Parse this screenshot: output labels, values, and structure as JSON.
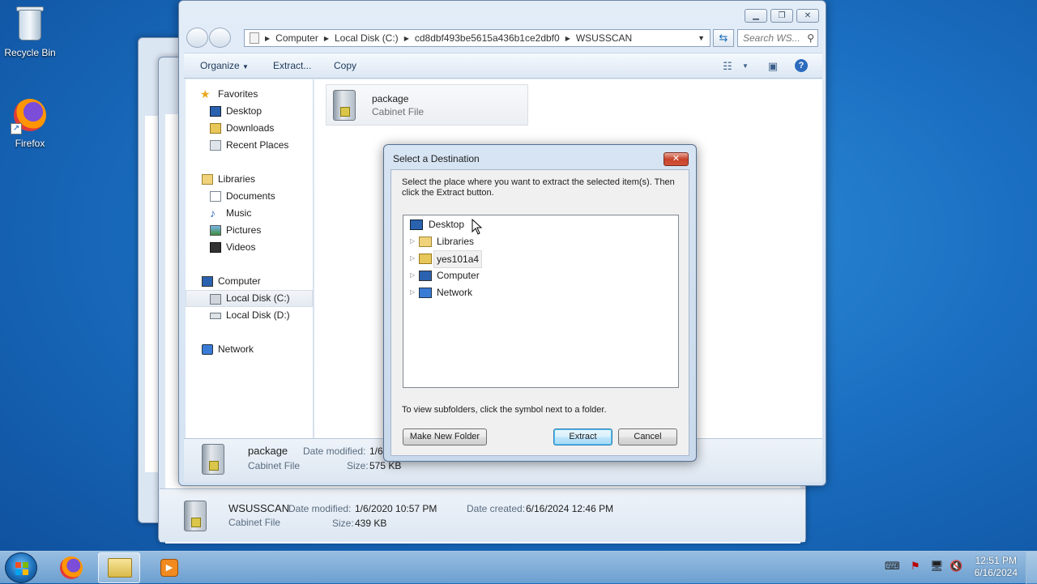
{
  "desktop": {
    "icons": [
      {
        "label": "Recycle Bin"
      },
      {
        "label": "Firefox"
      }
    ]
  },
  "explorer": {
    "address": [
      "Computer",
      "Local Disk (C:)",
      "cd8dbf493be5615a436b1ce2dbf0",
      "WSUSSCAN"
    ],
    "search_placeholder": "Search WS...",
    "toolbar": {
      "organize": "Organize",
      "extract": "Extract...",
      "copy": "Copy"
    },
    "nav": {
      "favorites": "Favorites",
      "desktop": "Desktop",
      "downloads": "Downloads",
      "recent": "Recent Places",
      "libraries": "Libraries",
      "documents": "Documents",
      "music": "Music",
      "pictures": "Pictures",
      "videos": "Videos",
      "computer": "Computer",
      "local_c": "Local Disk (C:)",
      "local_d": "Local Disk (D:)",
      "network": "Network"
    },
    "file": {
      "name": "package",
      "type": "Cabinet File"
    },
    "details": {
      "name": "package",
      "type": "Cabinet File",
      "date_modified_label": "Date modified:",
      "date_modified": "1/6",
      "size_label": "Size:",
      "size": "575 KB"
    }
  },
  "back_window_details": {
    "name": "WSUSSCAN",
    "type": "Cabinet File",
    "date_modified_label": "Date modified:",
    "date_modified": "1/6/2020 10:57 PM",
    "date_created_label": "Date created:",
    "date_created": "6/16/2024 12:46 PM",
    "size_label": "Size:",
    "size": "439 KB"
  },
  "dialog": {
    "title": "Select a Destination",
    "message": "Select the place where you want to extract the selected item(s).  Then click the Extract button.",
    "tree": [
      "Desktop",
      "Libraries",
      "yes101a4",
      "Computer",
      "Network"
    ],
    "hint": "To view subfolders, click the symbol next to a folder.",
    "make_new_folder": "Make New Folder",
    "extract": "Extract",
    "cancel": "Cancel"
  },
  "taskbar": {
    "time": "12:51 PM",
    "date": "6/16/2024"
  },
  "colors": {
    "accent": "#1b6fc2",
    "dialog_close": "#c8432b"
  }
}
